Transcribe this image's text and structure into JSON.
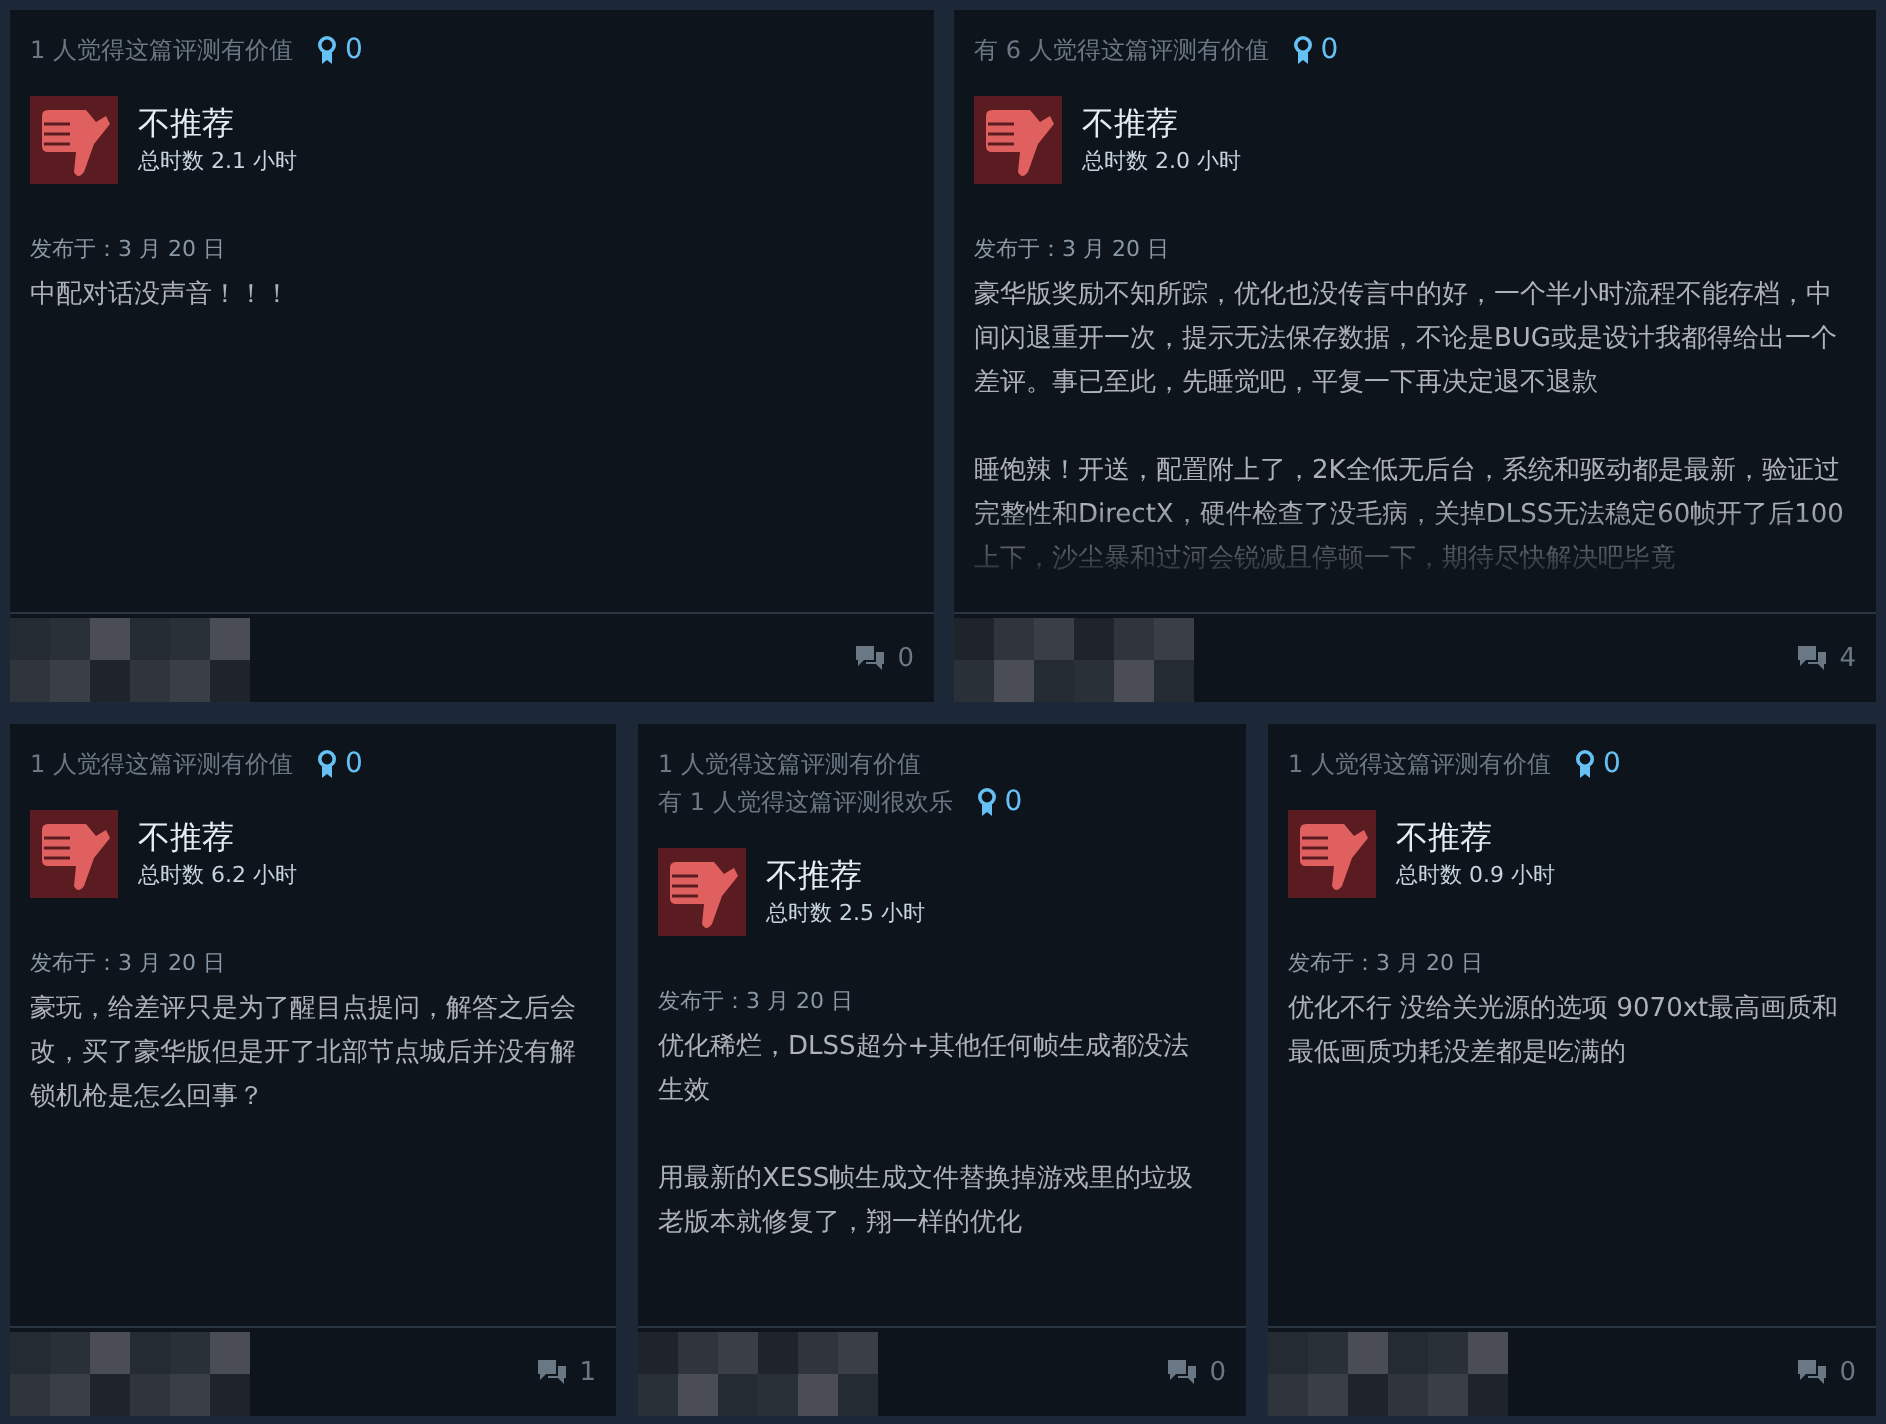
{
  "reviews": [
    {
      "helpful": [
        "1 人觉得这篇评测有价值"
      ],
      "awards": "0",
      "verdict": "不推荐",
      "recommended": false,
      "hours": "总时数 2.1 小时",
      "posted": "发布于：3 月 20 日",
      "body": [
        "中配对话没声音！！！"
      ],
      "comments": "0"
    },
    {
      "helpful": [
        "有 6 人觉得这篇评测有价值"
      ],
      "awards": "0",
      "verdict": "不推荐",
      "recommended": false,
      "hours": "总时数 2.0 小时",
      "posted": "发布于：3 月 20 日",
      "body": [
        "豪华版奖励不知所踪，优化也没传言中的好，一个半小时流程不能存档，中间闪退重开一次，提示无法保存数据，不论是BUG或是设计我都得给出一个差评。事已至此，先睡觉吧，平复一下再决定退不退款",
        "睡饱辣！开送，配置附上了，2K全低无后台，系统和驱动都是最新，验证过完整性和DirectX，硬件检查了没毛病，关掉DLSS无法稳定60帧开了后100上下，沙尘暴和过河会锐减且停顿一下，期待尽快解决吧毕竟"
      ],
      "truncated": true,
      "comments": "4"
    },
    {
      "helpful": [
        "1 人觉得这篇评测有价值"
      ],
      "awards": "0",
      "verdict": "不推荐",
      "recommended": false,
      "hours": "总时数 6.2 小时",
      "posted": "发布于：3 月 20 日",
      "body": [
        "豪玩，给差评只是为了醒目点提问，解答之后会改，买了豪华版但是开了北部节点城后并没有解锁机枪是怎么回事？"
      ],
      "comments": "1"
    },
    {
      "helpful": [
        "1 人觉得这篇评测有价值",
        "有 1 人觉得这篇评测很欢乐"
      ],
      "awards": "0",
      "verdict": "不推荐",
      "recommended": false,
      "hours": "总时数 2.5 小时",
      "posted": "发布于：3 月 20 日",
      "body": [
        "优化稀烂，DLSS超分+其他任何帧生成都没法生效",
        "用最新的XESS帧生成文件替换掉游戏里的垃圾老版本就修复了，翔一样的优化"
      ],
      "comments": "0"
    },
    {
      "helpful": [
        "1 人觉得这篇评测有价值"
      ],
      "awards": "0",
      "verdict": "不推荐",
      "recommended": false,
      "hours": "总时数 0.9 小时",
      "posted": "发布于：3 月 20 日",
      "body": [
        "优化不行 没给关光源的选项 9070xt最高画质和最低画质功耗没差都是吃满的"
      ],
      "comments": "0"
    }
  ]
}
